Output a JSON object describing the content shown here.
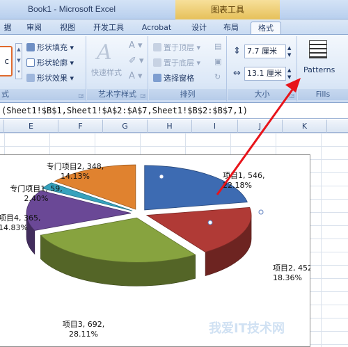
{
  "window": {
    "title": "Book1 - Microsoft Excel",
    "context_tab_group": "图表工具"
  },
  "tabs": [
    {
      "label": "据"
    },
    {
      "label": "审阅"
    },
    {
      "label": "视图"
    },
    {
      "label": "开发工具"
    },
    {
      "label": "Acrobat"
    },
    {
      "label": "设计"
    },
    {
      "label": "布局"
    },
    {
      "label": "格式",
      "active": true
    }
  ],
  "ribbon": {
    "shape_styles": {
      "fill": "形状填充",
      "outline": "形状轮廓",
      "effects": "形状效果",
      "preview": "c",
      "label": "式"
    },
    "wordart": {
      "quick_styles": "快速样式",
      "label": "艺术字样式"
    },
    "arrange": {
      "bring_front": "置于顶层",
      "send_back": "置于底层",
      "selection_pane": "选择窗格",
      "label": "排列"
    },
    "size": {
      "height": "7.7 厘米",
      "width": "13.1 厘米",
      "label": "大小"
    },
    "fills": {
      "patterns": "Patterns",
      "label": "Fills"
    }
  },
  "formula": "(Sheet1!$B$1,Sheet1!$A$2:$A$7,Sheet1!$B$2:$B$7,1)",
  "columns": [
    "E",
    "F",
    "G",
    "H",
    "I",
    "J",
    "K"
  ],
  "watermark": "我爱IT技术网",
  "chart_data": {
    "type": "pie",
    "slices": [
      {
        "name": "项目1",
        "value": 546,
        "percent": "22.18%",
        "color": "#3d6bb2"
      },
      {
        "name": "项目2",
        "value": 452,
        "percent": "18.36%",
        "color": "#b03a36"
      },
      {
        "name": "项目3",
        "value": 692,
        "percent": "28.11%",
        "color": "#87a33f"
      },
      {
        "name": "项目4",
        "value": 365,
        "percent": "14.83%",
        "color": "#6a4896"
      },
      {
        "name": "专门项目1",
        "value": 59,
        "percent": "2.40%",
        "color": "#36a2bd"
      },
      {
        "name": "专门项目2",
        "value": 348,
        "percent": "14.13%",
        "color": "#e0822f"
      }
    ],
    "labels": [
      {
        "line1": "项目1, 546,",
        "line2": "22.18%"
      },
      {
        "line1": "项目2, 452,",
        "line2": "18.36%"
      },
      {
        "line1": "项目3, 692,",
        "line2": "28.11%"
      },
      {
        "line1": "项目4, 365,",
        "line2": "14.83%"
      },
      {
        "line1": "专门项目1, 59,",
        "line2": "2.40%"
      },
      {
        "line1": "专门项目2, 348,",
        "line2": "14.13%"
      }
    ]
  }
}
